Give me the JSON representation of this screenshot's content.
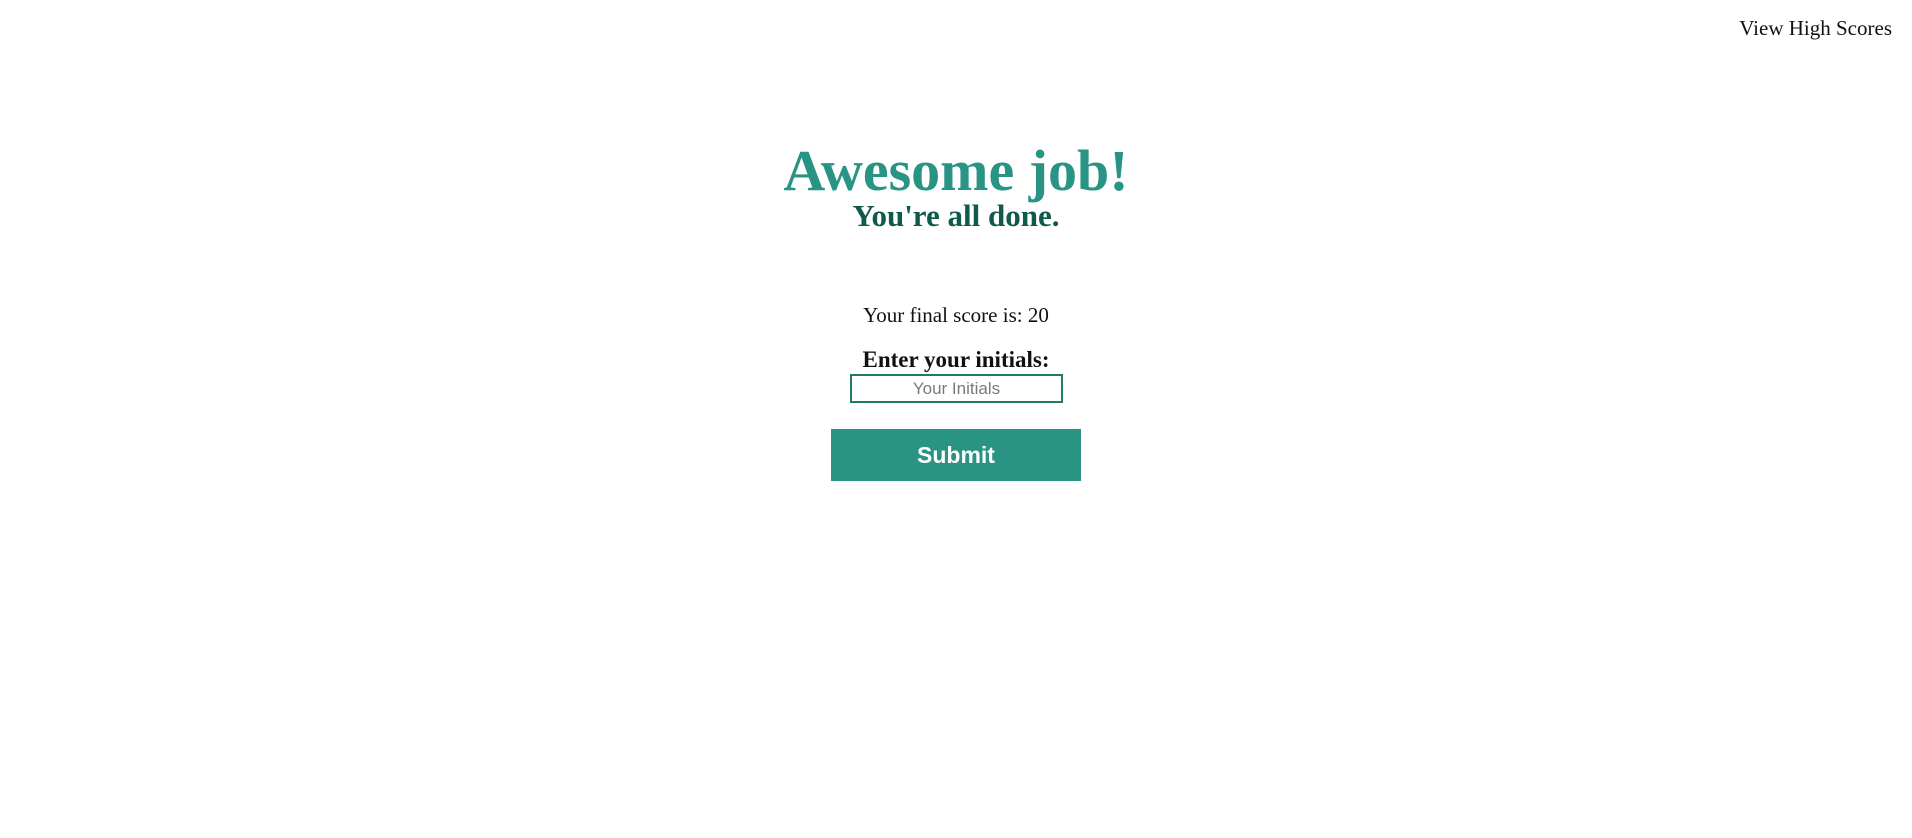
{
  "header": {
    "view_high_scores_label": "View High Scores"
  },
  "main": {
    "heading": "Awesome job!",
    "subheading": "You're all done.",
    "final_score_text": "Your final score is: 20",
    "initials_label": "Enter your initials:",
    "initials_input": {
      "value": "",
      "placeholder": "Your Initials"
    },
    "submit_label": "Submit"
  },
  "colors": {
    "accent": "#2a9484",
    "accent_dark": "#0f5a4c",
    "input_border": "#1f7a66",
    "text": "#111111",
    "background": "#ffffff"
  }
}
